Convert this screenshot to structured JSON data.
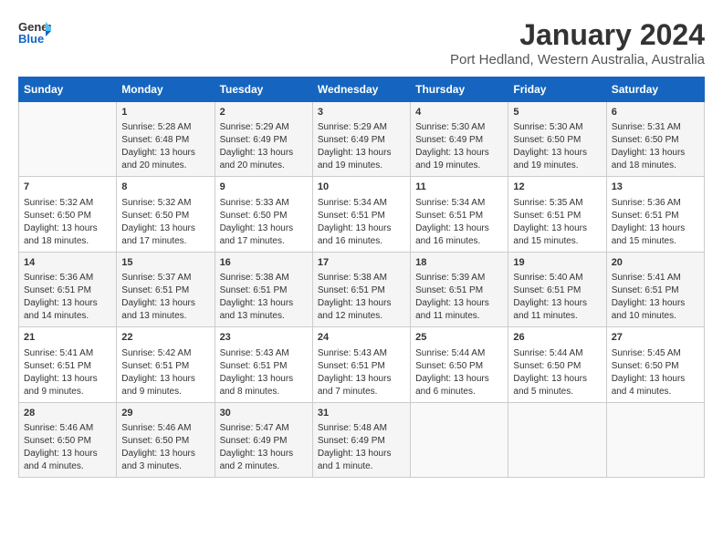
{
  "header": {
    "logo_line1": "General",
    "logo_line2": "Blue",
    "month_title": "January 2024",
    "subtitle": "Port Hedland, Western Australia, Australia"
  },
  "days_of_week": [
    "Sunday",
    "Monday",
    "Tuesday",
    "Wednesday",
    "Thursday",
    "Friday",
    "Saturday"
  ],
  "weeks": [
    [
      {
        "day": "",
        "content": ""
      },
      {
        "day": "1",
        "content": "Sunrise: 5:28 AM\nSunset: 6:48 PM\nDaylight: 13 hours\nand 20 minutes."
      },
      {
        "day": "2",
        "content": "Sunrise: 5:29 AM\nSunset: 6:49 PM\nDaylight: 13 hours\nand 20 minutes."
      },
      {
        "day": "3",
        "content": "Sunrise: 5:29 AM\nSunset: 6:49 PM\nDaylight: 13 hours\nand 19 minutes."
      },
      {
        "day": "4",
        "content": "Sunrise: 5:30 AM\nSunset: 6:49 PM\nDaylight: 13 hours\nand 19 minutes."
      },
      {
        "day": "5",
        "content": "Sunrise: 5:30 AM\nSunset: 6:50 PM\nDaylight: 13 hours\nand 19 minutes."
      },
      {
        "day": "6",
        "content": "Sunrise: 5:31 AM\nSunset: 6:50 PM\nDaylight: 13 hours\nand 18 minutes."
      }
    ],
    [
      {
        "day": "7",
        "content": "Sunrise: 5:32 AM\nSunset: 6:50 PM\nDaylight: 13 hours\nand 18 minutes."
      },
      {
        "day": "8",
        "content": "Sunrise: 5:32 AM\nSunset: 6:50 PM\nDaylight: 13 hours\nand 17 minutes."
      },
      {
        "day": "9",
        "content": "Sunrise: 5:33 AM\nSunset: 6:50 PM\nDaylight: 13 hours\nand 17 minutes."
      },
      {
        "day": "10",
        "content": "Sunrise: 5:34 AM\nSunset: 6:51 PM\nDaylight: 13 hours\nand 16 minutes."
      },
      {
        "day": "11",
        "content": "Sunrise: 5:34 AM\nSunset: 6:51 PM\nDaylight: 13 hours\nand 16 minutes."
      },
      {
        "day": "12",
        "content": "Sunrise: 5:35 AM\nSunset: 6:51 PM\nDaylight: 13 hours\nand 15 minutes."
      },
      {
        "day": "13",
        "content": "Sunrise: 5:36 AM\nSunset: 6:51 PM\nDaylight: 13 hours\nand 15 minutes."
      }
    ],
    [
      {
        "day": "14",
        "content": "Sunrise: 5:36 AM\nSunset: 6:51 PM\nDaylight: 13 hours\nand 14 minutes."
      },
      {
        "day": "15",
        "content": "Sunrise: 5:37 AM\nSunset: 6:51 PM\nDaylight: 13 hours\nand 13 minutes."
      },
      {
        "day": "16",
        "content": "Sunrise: 5:38 AM\nSunset: 6:51 PM\nDaylight: 13 hours\nand 13 minutes."
      },
      {
        "day": "17",
        "content": "Sunrise: 5:38 AM\nSunset: 6:51 PM\nDaylight: 13 hours\nand 12 minutes."
      },
      {
        "day": "18",
        "content": "Sunrise: 5:39 AM\nSunset: 6:51 PM\nDaylight: 13 hours\nand 11 minutes."
      },
      {
        "day": "19",
        "content": "Sunrise: 5:40 AM\nSunset: 6:51 PM\nDaylight: 13 hours\nand 11 minutes."
      },
      {
        "day": "20",
        "content": "Sunrise: 5:41 AM\nSunset: 6:51 PM\nDaylight: 13 hours\nand 10 minutes."
      }
    ],
    [
      {
        "day": "21",
        "content": "Sunrise: 5:41 AM\nSunset: 6:51 PM\nDaylight: 13 hours\nand 9 minutes."
      },
      {
        "day": "22",
        "content": "Sunrise: 5:42 AM\nSunset: 6:51 PM\nDaylight: 13 hours\nand 9 minutes."
      },
      {
        "day": "23",
        "content": "Sunrise: 5:43 AM\nSunset: 6:51 PM\nDaylight: 13 hours\nand 8 minutes."
      },
      {
        "day": "24",
        "content": "Sunrise: 5:43 AM\nSunset: 6:51 PM\nDaylight: 13 hours\nand 7 minutes."
      },
      {
        "day": "25",
        "content": "Sunrise: 5:44 AM\nSunset: 6:50 PM\nDaylight: 13 hours\nand 6 minutes."
      },
      {
        "day": "26",
        "content": "Sunrise: 5:44 AM\nSunset: 6:50 PM\nDaylight: 13 hours\nand 5 minutes."
      },
      {
        "day": "27",
        "content": "Sunrise: 5:45 AM\nSunset: 6:50 PM\nDaylight: 13 hours\nand 4 minutes."
      }
    ],
    [
      {
        "day": "28",
        "content": "Sunrise: 5:46 AM\nSunset: 6:50 PM\nDaylight: 13 hours\nand 4 minutes."
      },
      {
        "day": "29",
        "content": "Sunrise: 5:46 AM\nSunset: 6:50 PM\nDaylight: 13 hours\nand 3 minutes."
      },
      {
        "day": "30",
        "content": "Sunrise: 5:47 AM\nSunset: 6:49 PM\nDaylight: 13 hours\nand 2 minutes."
      },
      {
        "day": "31",
        "content": "Sunrise: 5:48 AM\nSunset: 6:49 PM\nDaylight: 13 hours\nand 1 minute."
      },
      {
        "day": "",
        "content": ""
      },
      {
        "day": "",
        "content": ""
      },
      {
        "day": "",
        "content": ""
      }
    ]
  ]
}
